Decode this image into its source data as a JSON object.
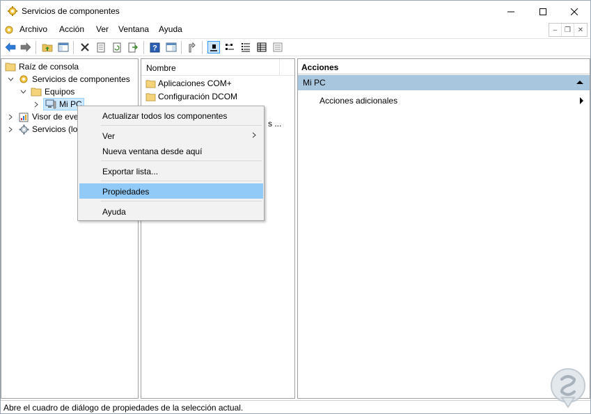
{
  "window": {
    "title": "Servicios de componentes",
    "controls": {
      "minimize": "minimize",
      "maximize": "maximize",
      "close": "close"
    }
  },
  "menubar": {
    "items": [
      "Archivo",
      "Acción",
      "Ver",
      "Ventana",
      "Ayuda"
    ]
  },
  "tree": {
    "items": [
      {
        "label": "Raíz de consola"
      },
      {
        "label": "Servicios de componentes"
      },
      {
        "label": "Equipos"
      },
      {
        "label": "Mi PC"
      },
      {
        "label": "Visor de eve"
      },
      {
        "label": "Servicios (lo"
      }
    ]
  },
  "list": {
    "column_header": "Nombre",
    "rows": [
      {
        "label": "Aplicaciones COM+"
      },
      {
        "label": "Configuración DCOM"
      },
      {
        "label": "s ..."
      }
    ]
  },
  "actions": {
    "header": "Acciones",
    "section": "Mi PC",
    "more": "Acciones adicionales"
  },
  "context_menu": {
    "items": [
      {
        "label": "Actualizar todos los componentes"
      },
      {
        "label": "Ver"
      },
      {
        "label": "Nueva ventana desde aquí"
      },
      {
        "label": "Exportar lista..."
      },
      {
        "label": "Propiedades"
      },
      {
        "label": "Ayuda"
      }
    ],
    "highlight_color": "#91c9f7"
  },
  "statusbar": {
    "text": "Abre el cuadro de diálogo de propiedades de la selección actual."
  },
  "colors": {
    "selection": "#cce8ff",
    "actions_section": "#a9c6df",
    "toolbar_active": "#cce4f7"
  }
}
